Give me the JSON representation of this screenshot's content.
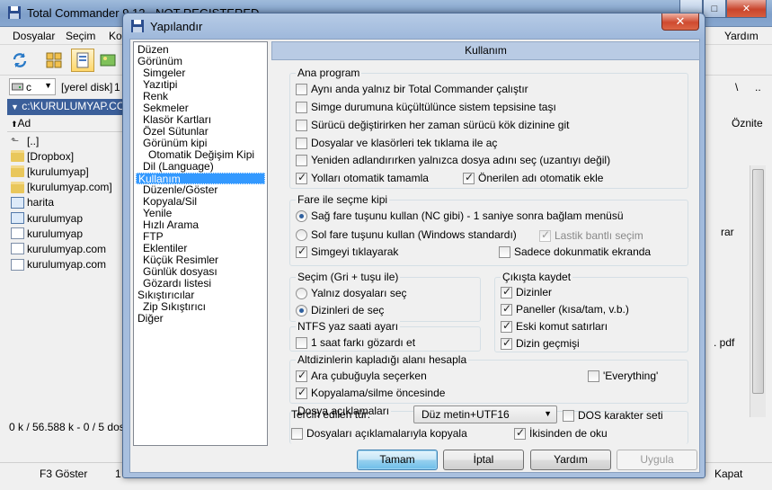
{
  "tc": {
    "title": "Total Commander 9.12 - NOT REGISTERED",
    "menu": [
      "Dosyalar",
      "Seçim",
      "Ko"
    ],
    "menu_right": "Yardım",
    "drive": "c",
    "drive_label": "[yerel disk]",
    "drive_extra": "1",
    "path": "c:\\KURULUMYAP.COM",
    "col_name": "Ad",
    "col_attr": "Öznite",
    "files": [
      {
        "name": "[..]",
        "icon": "up-icon"
      },
      {
        "name": "[Dropbox]",
        "icon": "folder-icon"
      },
      {
        "name": "[kurulumyap]",
        "icon": "folder-icon"
      },
      {
        "name": "[kurulumyap.com]",
        "icon": "folder-icon"
      },
      {
        "name": "harita",
        "icon": "file-icon"
      },
      {
        "name": "kurulumyap",
        "icon": "file-icon"
      },
      {
        "name": "kurulumyap",
        "icon": "file-icon"
      },
      {
        "name": "kurulumyap.com",
        "icon": "file-icon"
      },
      {
        "name": "kurulumyap.com",
        "icon": "file-icon"
      }
    ],
    "right_snippets": {
      "rar": "rar",
      "pdf": ". pdf",
      "slash": "\\",
      "dots": ".."
    },
    "status": "0 k / 56.588 k - 0 / 5 dos",
    "fkeys": {
      "f3": "F3 Göster",
      "f1": "1",
      "kapat": "Kapat"
    }
  },
  "dialog": {
    "title": "Yapılandır",
    "close_symbol": "✕",
    "tree": [
      {
        "label": "Düzen",
        "indent": 0
      },
      {
        "label": "Görünüm",
        "indent": 0
      },
      {
        "label": "Simgeler",
        "indent": 1
      },
      {
        "label": "Yazıtipi",
        "indent": 1
      },
      {
        "label": "Renk",
        "indent": 1
      },
      {
        "label": "Sekmeler",
        "indent": 1
      },
      {
        "label": "Klasör Kartları",
        "indent": 1
      },
      {
        "label": "Özel Sütunlar",
        "indent": 1
      },
      {
        "label": "Görünüm kipi",
        "indent": 1
      },
      {
        "label": "Otomatik Değişim Kipi",
        "indent": 2
      },
      {
        "label": "Dil (Language)",
        "indent": 1
      },
      {
        "label": "Kullanım",
        "indent": 0,
        "selected": true
      },
      {
        "label": "Düzenle/Göster",
        "indent": 1
      },
      {
        "label": "Kopyala/Sil",
        "indent": 1
      },
      {
        "label": "Yenile",
        "indent": 1
      },
      {
        "label": "Hızlı Arama",
        "indent": 1
      },
      {
        "label": "FTP",
        "indent": 1
      },
      {
        "label": "Eklentiler",
        "indent": 1
      },
      {
        "label": "Küçük Resimler",
        "indent": 1
      },
      {
        "label": "Günlük dosyası",
        "indent": 1
      },
      {
        "label": "Gözardı listesi",
        "indent": 1
      },
      {
        "label": "Sıkıştırıcılar",
        "indent": 0
      },
      {
        "label": "Zip Sıkıştırıcı",
        "indent": 1
      },
      {
        "label": "Diğer",
        "indent": 0
      }
    ],
    "panel_title": "Kullanım",
    "groups": {
      "ana_program": {
        "title": "Ana program",
        "opts": [
          {
            "label": "Aynı anda yalnız bir Total Commander çalıştır",
            "checked": false
          },
          {
            "label": "Simge durumuna küçültülünce sistem tepsisine taşı",
            "checked": false
          },
          {
            "label": "Sürücü değiştirirken her zaman sürücü kök dizinine git",
            "checked": false
          },
          {
            "label": "Dosyalar ve klasörleri tek tıklama ile aç",
            "checked": false
          },
          {
            "label": "Yeniden adlandırırken yalnızca dosya adını seç (uzantıyı değil)",
            "checked": false
          },
          {
            "label": "Yolları otomatik tamamla",
            "checked": true
          },
          {
            "label": "Önerilen adı otomatik ekle",
            "checked": true
          }
        ]
      },
      "fare": {
        "title": "Fare ile seçme kipi",
        "radios": [
          {
            "label": "Sağ fare tuşunu kullan (NC gibi) - 1 saniye sonra bağlam menüsü",
            "checked": true
          },
          {
            "label": "Sol fare tuşunu kullan (Windows standardı)",
            "checked": false
          }
        ],
        "lastik": {
          "label": "Lastik bantlı seçim",
          "checked": true
        },
        "simgeyi": {
          "label": "Simgeyi tıklayarak",
          "checked": true
        },
        "dokunmatik": {
          "label": "Sadece dokunmatik ekranda",
          "checked": false
        }
      },
      "secim": {
        "title": "Seçim (Gri + tuşu ile)",
        "radios": [
          {
            "label": "Yalnız dosyaları seç",
            "checked": false
          },
          {
            "label": "Dizinleri de seç",
            "checked": true
          }
        ]
      },
      "cikista": {
        "title": "Çıkışta kaydet",
        "opts": [
          {
            "label": "Dizinler",
            "checked": true
          },
          {
            "label": "Paneller (kısa/tam, v.b.)",
            "checked": true
          },
          {
            "label": "Eski komut satırları",
            "checked": true
          },
          {
            "label": "Dizin geçmişi",
            "checked": true
          }
        ]
      },
      "ntfs": {
        "title": "NTFS yaz saati ayarı",
        "opt": {
          "label": "1 saat farkı gözardı et",
          "checked": false
        }
      },
      "altdizin": {
        "title": "Altdizinlerin kapladığı alanı hesapla",
        "opts": [
          {
            "label": "Ara çubuğuyla seçerken",
            "checked": true
          },
          {
            "label": "'Everything'",
            "checked": false
          },
          {
            "label": "Kopyalama/silme öncesinde",
            "checked": true
          }
        ]
      },
      "aciklama": {
        "title": "Dosya açıklamaları",
        "pref_label": "Tercih edilen tür:",
        "pref_value": "Düz metin+UTF16",
        "dos": {
          "label": "DOS karakter seti",
          "checked": false
        },
        "copy": {
          "label": "Dosyaları açıklamalarıyla kopyala",
          "checked": false
        },
        "both": {
          "label": "İkisinden de oku",
          "checked": true
        }
      }
    },
    "buttons": {
      "ok": "Tamam",
      "cancel": "İptal",
      "help": "Yardım",
      "apply": "Uygula"
    }
  }
}
